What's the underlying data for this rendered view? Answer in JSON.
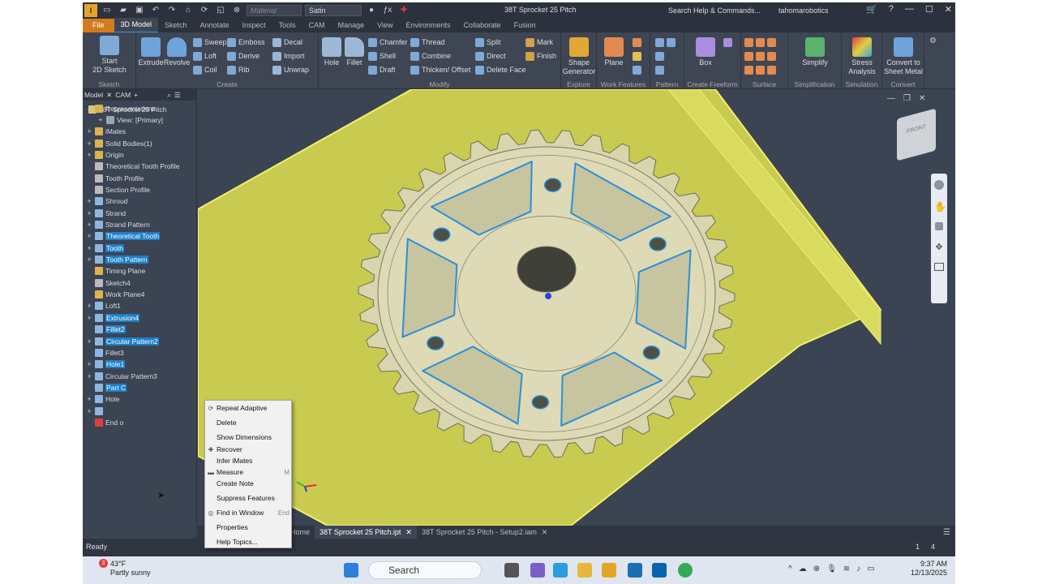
{
  "app": {
    "title": "38T Sprocket 25 Pitch",
    "logo": "I",
    "material": "Material",
    "appearance": "Satin",
    "search": "Search Help & Commands...",
    "user": "tahomarobotics"
  },
  "tabs": [
    "File",
    "3D Model",
    "Sketch",
    "Annotate",
    "Inspect",
    "Tools",
    "CAM",
    "Manage",
    "View",
    "Environments",
    "Collaborate",
    "Fusion"
  ],
  "ribbon": {
    "sketch": {
      "start": "Start",
      "start2": "2D Sketch",
      "label": "Sketch"
    },
    "create": {
      "extrude": "Extrude",
      "revolve": "Revolve",
      "sweep": "Sweep",
      "loft": "Loft",
      "coil": "Coil",
      "emboss": "Emboss",
      "derive": "Derive",
      "rib": "Rib",
      "decal": "Decal",
      "import": "Import",
      "unwrap": "Unwrap",
      "label": "Create"
    },
    "modify": {
      "hole": "Hole",
      "fillet": "Fillet",
      "chamfer": "Chamfer",
      "shell": "Shell",
      "draft": "Draft",
      "thread": "Thread",
      "combine": "Combine",
      "thicken": "Thicken/ Offset",
      "split": "Split",
      "direct": "Direct",
      "delete_face": "Delete Face",
      "mark": "Mark",
      "finish": "Finish",
      "label": "Modify"
    },
    "explore": {
      "shape_gen": "Shape",
      "shape_gen2": "Generator",
      "label": "Explore"
    },
    "work": {
      "plane": "Plane",
      "label": "Work Features"
    },
    "pattern": {
      "label": "Pattern"
    },
    "freeform": {
      "box": "Box",
      "label": "Create Freeform"
    },
    "surface": {
      "label": "Surface"
    },
    "simplification": {
      "simplify": "Simplify",
      "label": "Simplification"
    },
    "simulation": {
      "stress": "Stress",
      "stress2": "Analysis",
      "label": "Simulation"
    },
    "convert": {
      "sheet": "Convert to",
      "sheet2": "Sheet Metal",
      "label": "Convert"
    }
  },
  "panel": {
    "tab_model": "Model",
    "tab_cam": "CAM",
    "root": "38T Sprocket 25 Pitch"
  },
  "tree": [
    {
      "label": "Representations",
      "exp": "−",
      "color": "#d9b450",
      "sel": false
    },
    {
      "label": "View: [Primary]",
      "exp": "+",
      "color": "#9aa4b0",
      "sel": false,
      "indent": 1
    },
    {
      "label": "iMates",
      "exp": "+",
      "color": "#d9b450",
      "sel": false
    },
    {
      "label": "Solid Bodies(1)",
      "exp": "+",
      "color": "#d9b450",
      "sel": false
    },
    {
      "label": "Origin",
      "exp": "+",
      "color": "#d9b450",
      "sel": false
    },
    {
      "label": "Theoretical Tooth Profile",
      "exp": "",
      "color": "#bbb",
      "sel": false
    },
    {
      "label": "Tooth Profile",
      "exp": "",
      "color": "#bbb",
      "sel": false
    },
    {
      "label": "Section Profile",
      "exp": "",
      "color": "#bbb",
      "sel": false
    },
    {
      "label": "Shroud",
      "exp": "+",
      "color": "#8fb6de",
      "sel": false
    },
    {
      "label": "Strand",
      "exp": "+",
      "color": "#8fb6de",
      "sel": false
    },
    {
      "label": "Strand Pattern",
      "exp": "+",
      "color": "#8fb6de",
      "sel": false
    },
    {
      "label": "Theoretical Tooth",
      "exp": "+",
      "color": "#8fb6de",
      "sel": true
    },
    {
      "label": "Tooth",
      "exp": "+",
      "color": "#8fb6de",
      "sel": true
    },
    {
      "label": "Tooth Pattern",
      "exp": "+",
      "color": "#8fb6de",
      "sel": true
    },
    {
      "label": "Timing Plane",
      "exp": "",
      "color": "#e2b04a",
      "sel": false
    },
    {
      "label": "Sketch4",
      "exp": "",
      "color": "#bbb",
      "sel": false
    },
    {
      "label": "Work Plane4",
      "exp": "",
      "color": "#e2b04a",
      "sel": false
    },
    {
      "label": "Loft1",
      "exp": "+",
      "color": "#8fb6de",
      "sel": false
    },
    {
      "label": "Extrusion4",
      "exp": "+",
      "color": "#8fb6de",
      "sel": true
    },
    {
      "label": "Fillet2",
      "exp": "",
      "color": "#8fb6de",
      "sel": true
    },
    {
      "label": "Circular Pattern2",
      "exp": "+",
      "color": "#8fb6de",
      "sel": true
    },
    {
      "label": "Fillet3",
      "exp": "",
      "color": "#8fb6de",
      "sel": false
    },
    {
      "label": "Hole1",
      "exp": "+",
      "color": "#8fb6de",
      "sel": true
    },
    {
      "label": "Circular Pattern3",
      "exp": "+",
      "color": "#8fb6de",
      "sel": false
    },
    {
      "label": "Part C",
      "exp": "",
      "color": "#8fb6de",
      "sel": true
    },
    {
      "label": "Hole",
      "exp": "+",
      "color": "#8fb6de",
      "sel": false
    },
    {
      "label": "",
      "exp": "+",
      "color": "#8fb6de",
      "sel": false
    },
    {
      "label": "End o",
      "exp": "",
      "color": "#e04040",
      "sel": false
    }
  ],
  "context_menu": [
    {
      "label": "Repeat Adaptive",
      "icon": "⟳",
      "shortcut": ""
    },
    {
      "label": "Delete",
      "icon": "",
      "shortcut": ""
    },
    {
      "label": "Show Dimensions",
      "icon": "",
      "shortcut": ""
    },
    {
      "label": "Recover",
      "icon": "✚",
      "shortcut": ""
    },
    {
      "label": "Infer iMates",
      "icon": "",
      "shortcut": ""
    },
    {
      "label": "Measure",
      "icon": "▬",
      "shortcut": "M"
    },
    {
      "label": "Create Note",
      "icon": "",
      "shortcut": ""
    },
    {
      "label": "Suppress Features",
      "icon": "",
      "shortcut": ""
    },
    {
      "label": "Find in Window",
      "icon": "◎",
      "shortcut": "End"
    },
    {
      "label": "Properties",
      "icon": "",
      "shortcut": ""
    },
    {
      "label": "Help Topics...",
      "icon": "",
      "shortcut": ""
    }
  ],
  "viewcube": {
    "label": "FRONT"
  },
  "doc_tabs": {
    "home": "Home",
    "tab1": "38T Sprocket 25 Pitch.ipt",
    "tab2": "38T Sprocket 25 Pitch - Setup2.iam"
  },
  "status": {
    "text": "Ready",
    "count1": "1",
    "count2": "4"
  },
  "taskbar": {
    "temp": "43°F",
    "weather": "Partly sunny",
    "badge": "3",
    "search": "Search",
    "time": "9:37 AM",
    "date": "12/13/2025"
  },
  "colors": {
    "accent": "#2d9bdc",
    "file_tab": "#d47b1e",
    "selection": "#1f7fc7",
    "part": "#d8d4ab",
    "stock": "#e7e860"
  }
}
